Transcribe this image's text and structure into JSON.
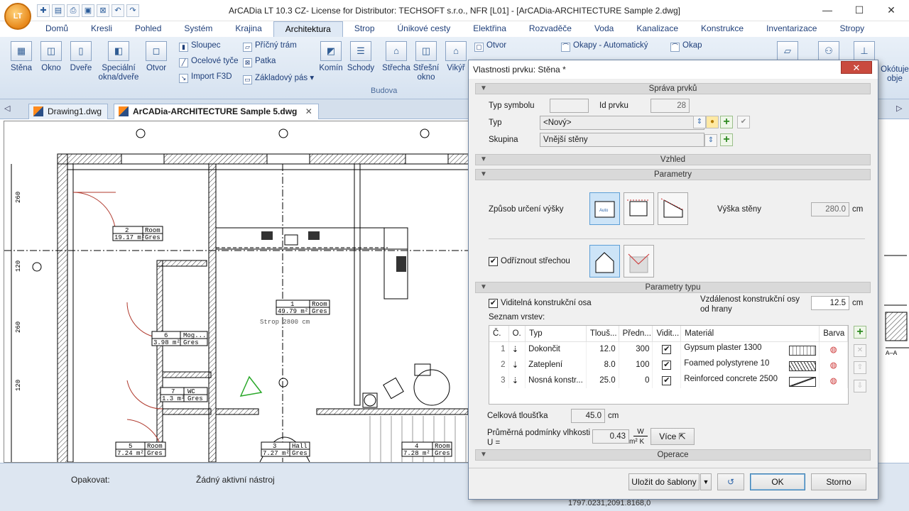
{
  "app": {
    "logo": "LT",
    "title": "ArCADia LT 10.3 CZ- License for Distributor: TECHSOFT s.r.o., NFR [L01] - [ArCADia-ARCHITECTURE Sample 2.dwg]",
    "window_buttons": {
      "minimize": "—",
      "maximize": "☐",
      "close": "✕"
    }
  },
  "quick_access": [
    "new-icon",
    "open-icon",
    "print-icon",
    "save-icon",
    "close-doc-icon",
    "undo-icon",
    "redo-icon"
  ],
  "menu_tabs": [
    "Domů",
    "Kresli",
    "Pohled",
    "Systém",
    "Krajina",
    "Architektura",
    "Strop",
    "Únikové cesty",
    "Elektřina",
    "Rozvaděče",
    "Voda",
    "Kanalizace",
    "Konstrukce",
    "Inventarizace",
    "Stropy"
  ],
  "active_tab": "Architektura",
  "ribbon": {
    "big_buttons": [
      {
        "label": "Stěna",
        "icon": "wall-icon"
      },
      {
        "label": "Okno",
        "icon": "window-icon"
      },
      {
        "label": "Dveře",
        "icon": "door-icon"
      },
      {
        "label": "Speciální okna/dveře",
        "icon": "special-window-icon"
      },
      {
        "label": "Otvor",
        "icon": "opening-icon"
      },
      {
        "label": "Komín",
        "icon": "chimney-icon"
      },
      {
        "label": "Schody",
        "icon": "stairs-icon"
      },
      {
        "label": "Střecha",
        "icon": "roof-icon"
      },
      {
        "label": "Střešní okno",
        "icon": "roof-window-icon"
      },
      {
        "label": "Vikýř",
        "icon": "dormer-icon"
      }
    ],
    "small_buttons": [
      "Sloupec",
      "Ocelové tyče",
      "Import F3D",
      "Příčný trám",
      "Patka",
      "Základový pás",
      "Otvor",
      "Okapy - Automatický",
      "Okap"
    ],
    "group_label": "Budova",
    "right_partial": "Okótuje obje"
  },
  "doc_tabs": [
    {
      "label": "Drawing1.dwg",
      "active": false
    },
    {
      "label": "ArCADia-ARCHITECTURE Sample 5.dwg",
      "active": true
    }
  ],
  "drawing": {
    "rooms": [
      {
        "num": "2",
        "name": "Room",
        "area": "19.17 m²",
        "finish": "Gres"
      },
      {
        "num": "1",
        "name": "Room",
        "area": "49.79 m²",
        "finish": "Gres"
      },
      {
        "num": "6",
        "name": "Mog...",
        "area": "3.98 m²",
        "finish": "Gres"
      },
      {
        "num": "7",
        "name": "WC",
        "area": "1.3 m²",
        "finish": "Gres"
      },
      {
        "num": "5",
        "name": "Room",
        "area": "7.24 m²",
        "finish": "Gres"
      },
      {
        "num": "3",
        "name": "Hall",
        "area": "7.27 m²",
        "finish": "Gres"
      },
      {
        "num": "4",
        "name": "Room",
        "area": "7.28 m²",
        "finish": "Gres"
      }
    ],
    "strop_note": "Strop 2800 cm",
    "dims": [
      "260",
      "120",
      "260",
      "120"
    ]
  },
  "status": {
    "repeat_label": "Opakovat:",
    "no_tool": "Žádný aktivní nástroj",
    "coords": "1797.0231,2091.8168,0"
  },
  "dialog": {
    "title": "Vlastnosti prvku: Stěna *",
    "close": "✕",
    "sections": {
      "sprava": "Správa prvků",
      "vzhled": "Vzhled",
      "parametry": "Parametry",
      "parametry_typu": "Parametry typu",
      "operace": "Operace"
    },
    "typ_symbolu_label": "Typ symbolu",
    "typ_symbolu_value": "",
    "id_prvku_label": "Id prvku",
    "id_prvku_value": "28",
    "typ_label": "Typ",
    "typ_value": "<Nový>",
    "skupina_label": "Skupina",
    "skupina_value": "Vnější stěny",
    "height_mode_label": "Způsob určení výšky",
    "wall_height_label": "Výška stěny",
    "wall_height_value": "280.0",
    "unit_cm": "cm",
    "cut_by_roof_label": "Odříznout střechou",
    "visible_axis_label": "Viditelná konstrukční osa",
    "axis_distance_label": "Vzdálenost konstrukční osy od hrany",
    "axis_distance_value": "12.5",
    "layer_list_label": "Seznam vrstev:",
    "layer_columns": [
      "Č.",
      "O.",
      "Typ",
      "Tlouš...",
      "Předn...",
      "Vidit...",
      "Materiál",
      "Barva"
    ],
    "layers": [
      {
        "no": "1",
        "type": "Dokončit",
        "thickness": "12.0",
        "priority": "300",
        "visible": "✔",
        "material": "Gypsum plaster 1300"
      },
      {
        "no": "2",
        "type": "Zateplení",
        "thickness": "8.0",
        "priority": "100",
        "visible": "✔",
        "material": "Foamed polystyrene 10"
      },
      {
        "no": "3",
        "type": "Nosná konstr...",
        "thickness": "25.0",
        "priority": "0",
        "visible": "✔",
        "material": "Reinforced concrete 2500"
      }
    ],
    "total_thickness_label": "Celková tloušťka",
    "total_thickness_value": "45.0",
    "humidity_label": "Průměrná podmínky vlhkosti U =",
    "humidity_value": "0.43",
    "humidity_unit_top": "W",
    "humidity_unit_bottom": "m² K",
    "more_button": "Více",
    "save_template_button": "Uložit do šablony",
    "ok_button": "OK",
    "cancel_button": "Storno"
  }
}
